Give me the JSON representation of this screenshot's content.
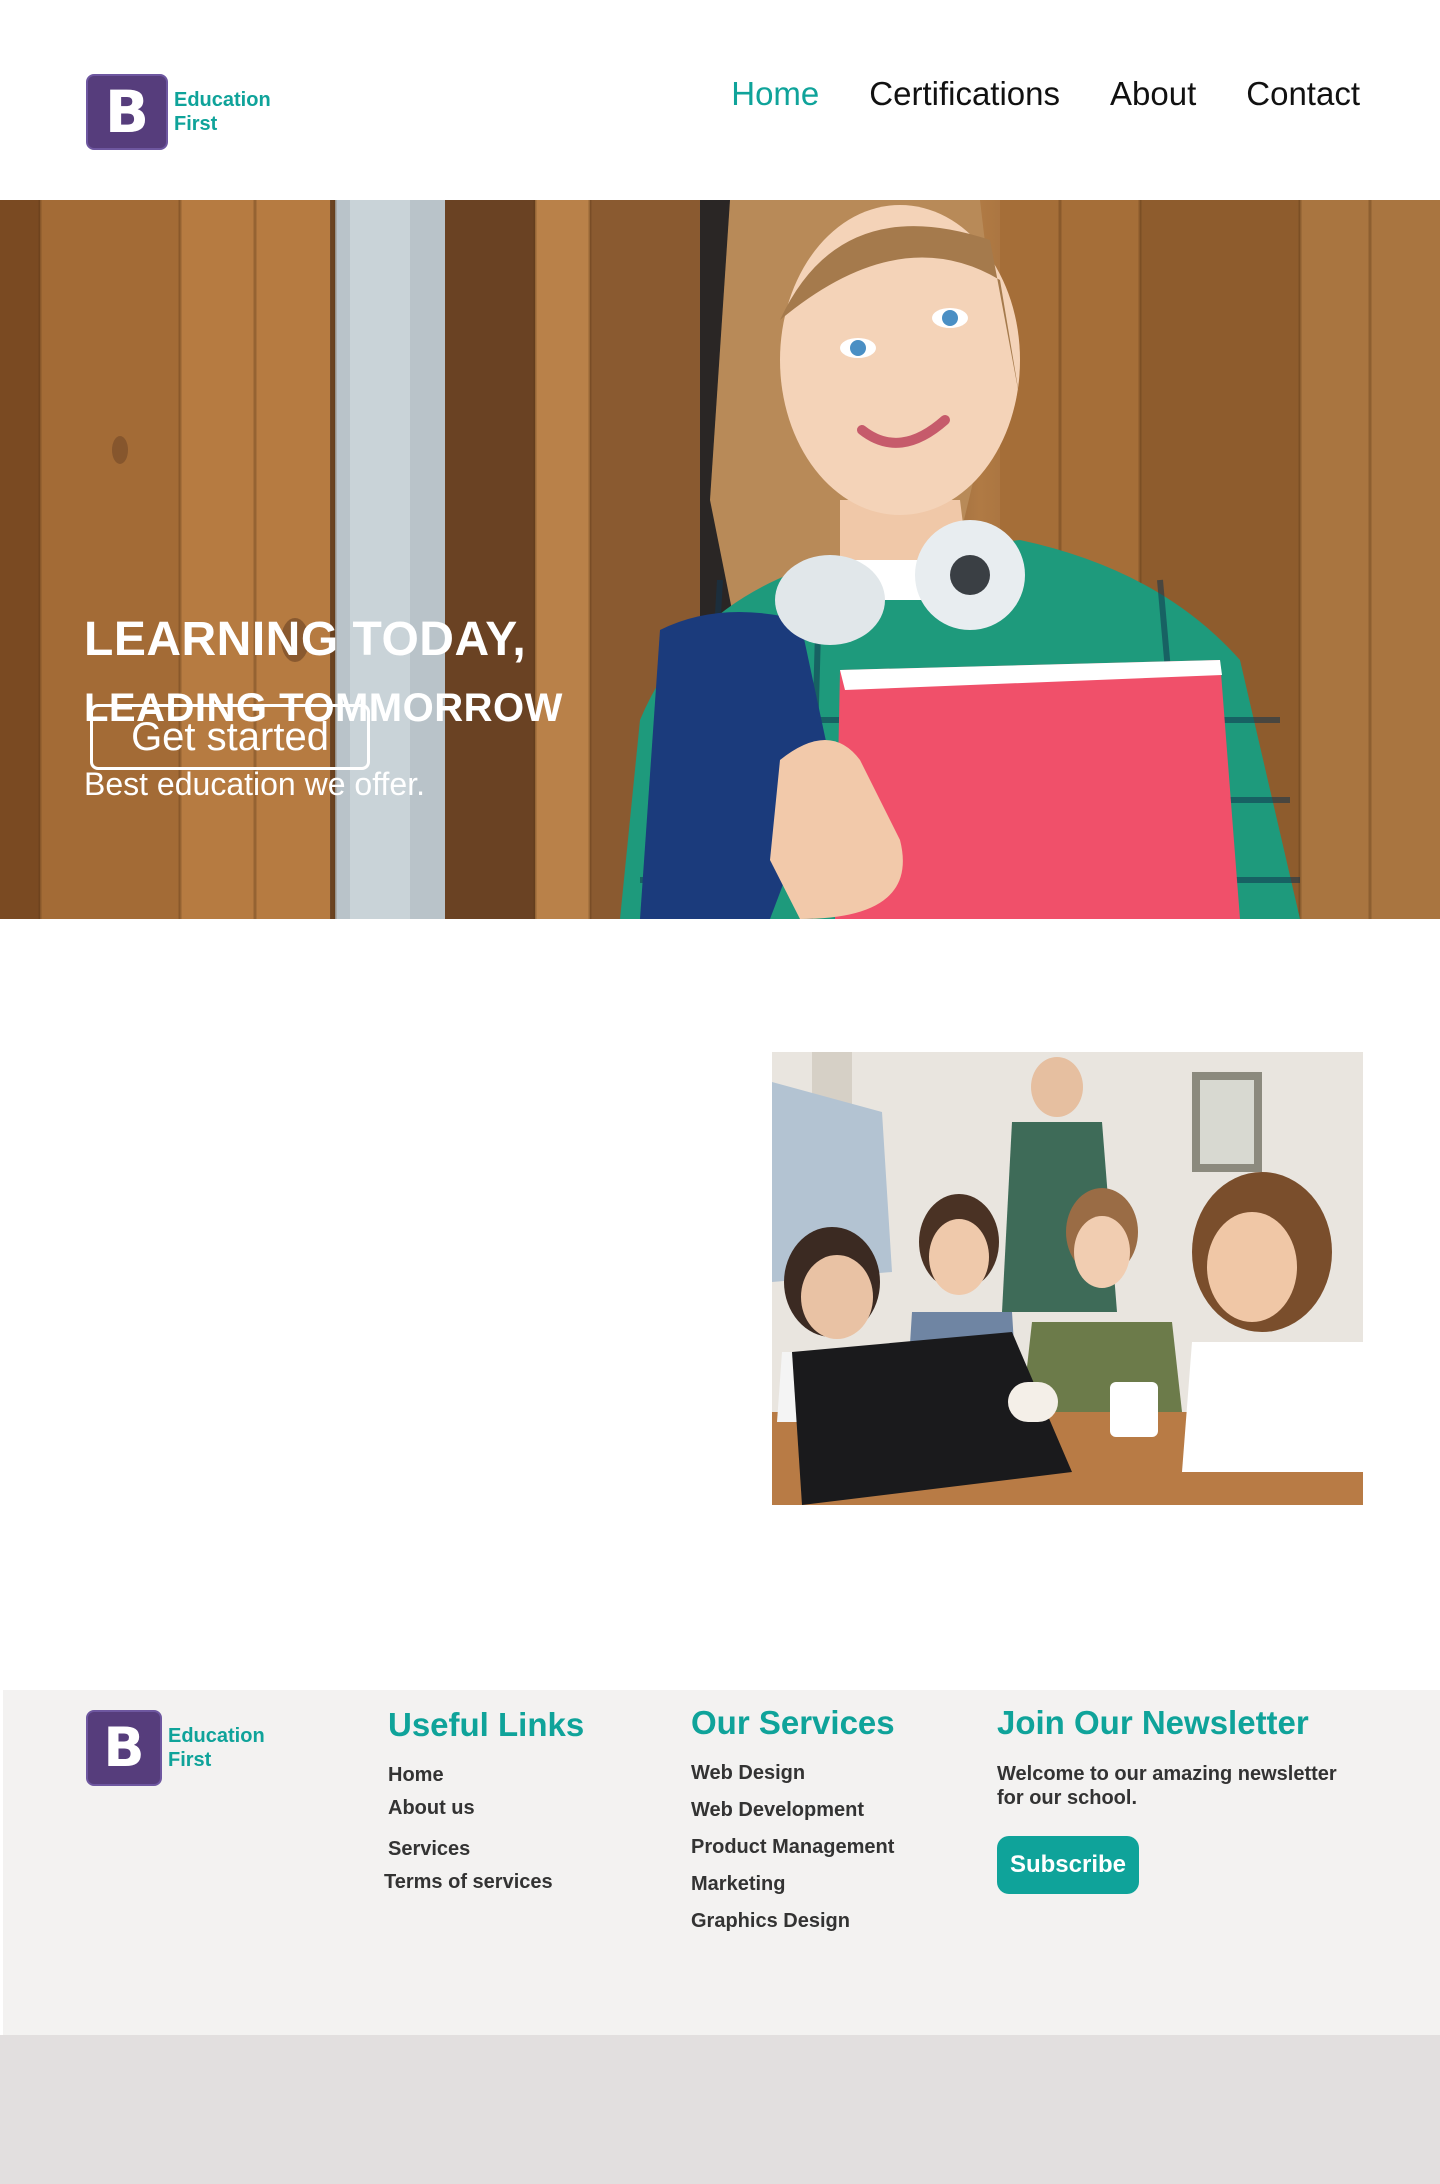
{
  "header": {
    "logo_letter": "B",
    "logo_line1": "Education",
    "logo_line2": "First",
    "nav": [
      "Home",
      "Certifications",
      "About",
      "Contact"
    ],
    "active_nav": "Home"
  },
  "hero": {
    "title_line1": "LEARNING TODAY,",
    "title_line2": "LEADING TOMMORROW",
    "subtitle": "Best education we offer.",
    "cta_label": "Get started"
  },
  "footer": {
    "logo_letter": "B",
    "logo_line1": "Education",
    "logo_line2": "First",
    "useful_links": {
      "heading": "Useful Links",
      "items": [
        "Home",
        "About us",
        "Services",
        "Terms of services"
      ]
    },
    "services": {
      "heading": "Our Services",
      "items": [
        "Web Design",
        "Web Development",
        "Product Management",
        "Marketing",
        "Graphics Design"
      ]
    },
    "newsletter": {
      "heading": "Join Our Newsletter",
      "text": "Welcome to our amazing newsletter for our school.",
      "button_label": "Subscribe"
    }
  },
  "colors": {
    "accent": "#0fa39a",
    "logo_bg": "#563d7c",
    "footer_bg": "#f3f2f1",
    "bottom_band": "#e2dfdf"
  }
}
